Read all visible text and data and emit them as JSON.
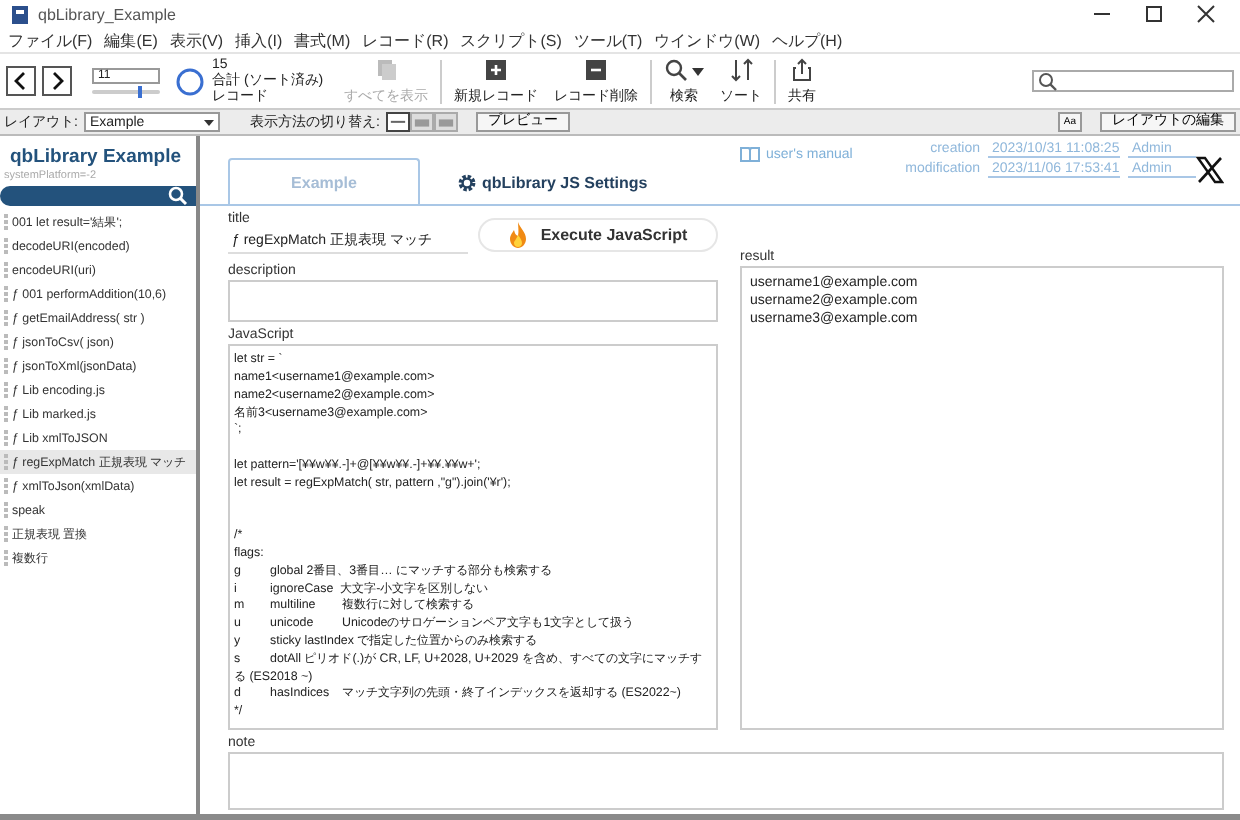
{
  "window": {
    "title": "qbLibrary_Example"
  },
  "menu": [
    "ファイル(F)",
    "編集(E)",
    "表示(V)",
    "挿入(I)",
    "書式(M)",
    "レコード(R)",
    "スクリプト(S)",
    "ツール(T)",
    "ウインドウ(W)",
    "ヘルプ(H)"
  ],
  "toolbar": {
    "record_number": "11",
    "slider": {
      "level": 0.7
    },
    "found_count": "15",
    "total_label": "合計 (ソート済み)",
    "records_label": "レコード",
    "buttons": [
      {
        "kind": "show-all",
        "label": "すべてを表示",
        "disabled": true
      },
      {
        "kind": "new",
        "label": "新規レコード",
        "disabled": false
      },
      {
        "kind": "delete",
        "label": "レコード削除",
        "disabled": false
      },
      {
        "kind": "search",
        "label": "検索",
        "disabled": false
      },
      {
        "kind": "sort",
        "label": "ソート",
        "disabled": false
      },
      {
        "kind": "share",
        "label": "共有",
        "disabled": false
      }
    ]
  },
  "layout_bar": {
    "layout_label": "レイアウト:",
    "layout_value": "Example",
    "view_label": "表示方法の切り替え:",
    "view_modes": [
      {
        "kind": "form",
        "selected": true
      },
      {
        "kind": "list",
        "selected": false
      },
      {
        "kind": "table",
        "selected": false
      }
    ],
    "preview": "プレビュー",
    "text_size": "Aa",
    "edit_layout": "レイアウトの編集"
  },
  "sidebar": {
    "title": "qbLibrary Example",
    "subtitle": "systemPlatform=-2",
    "items": [
      {
        "label": "001 let result='結果';",
        "selected": false
      },
      {
        "label": "decodeURI(encoded)",
        "selected": false
      },
      {
        "label": "encodeURI(uri)",
        "selected": false
      },
      {
        "label": "ƒ 001 performAddition(10,6)",
        "selected": false
      },
      {
        "label": "ƒ getEmailAddress( str )",
        "selected": false
      },
      {
        "label": "ƒ jsonToCsv( json)",
        "selected": false
      },
      {
        "label": "ƒ jsonToXml(jsonData)",
        "selected": false
      },
      {
        "label": "ƒ Lib encoding.js",
        "selected": false
      },
      {
        "label": "ƒ Lib marked.js",
        "selected": false
      },
      {
        "label": "ƒ Lib xmlToJSON",
        "selected": false
      },
      {
        "label": "ƒ regExpMatch 正規表現 マッチ",
        "selected": true
      },
      {
        "label": "ƒ xmlToJson(xmlData)",
        "selected": false
      },
      {
        "label": "speak",
        "selected": false
      },
      {
        "label": "正規表現 置換",
        "selected": false
      },
      {
        "label": "複数行",
        "selected": false
      }
    ]
  },
  "header": {
    "tabs": [
      {
        "label": "Example",
        "selected": true,
        "kind": "plain"
      },
      {
        "label": "qbLibrary JS Settings",
        "selected": false,
        "kind": "settings"
      }
    ],
    "manual_link": "user's manual",
    "creation": {
      "label": "creation",
      "date": "2023/10/31 11:08:25",
      "user": "Admin"
    },
    "modification": {
      "label": "modification",
      "date": "2023/11/06 17:53:41",
      "user": "Admin"
    }
  },
  "form": {
    "title_label": "title",
    "title_value": "ƒ regExpMatch 正規表現 マッチ",
    "execute_button": "Execute JavaScript",
    "description_label": "description",
    "javascript_label": "JavaScript",
    "javascript_value": "let str = `\nname1<username1@example.com>\nname2<username2@example.com>\n名前3<username3@example.com>\n`;\n\nlet pattern='[¥¥w¥¥.-]+@[¥¥w¥¥.-]+¥¥.¥¥w+';\nlet result = regExpMatch( str, pattern ,\"g\").join('¥r');\n\n\n/*\nflags:\ng\tglobal 2番目、3番目… にマッチする部分も検索する\ni\tignoreCase  大文字-小文字を区別しない\nm\tmultiline\t複数行に対して検索する\nu\tunicode\tUnicodeのサロゲーションペア文字も1文字として扱う\ny\tsticky lastIndex で指定した位置からのみ検索する\ns\tdotAll ピリオド(.)が CR, LF, U+2028, U+2029 を含め、すべての文字にマッチする (ES2018 ~)\nd\thasIndices\tマッチ文字列の先頭・終了インデックスを返却する (ES2022~)\n*/",
    "result_label": "result",
    "result_value": "username1@example.com\nusername2@example.com\nusername3@example.com",
    "note_label": "note"
  }
}
